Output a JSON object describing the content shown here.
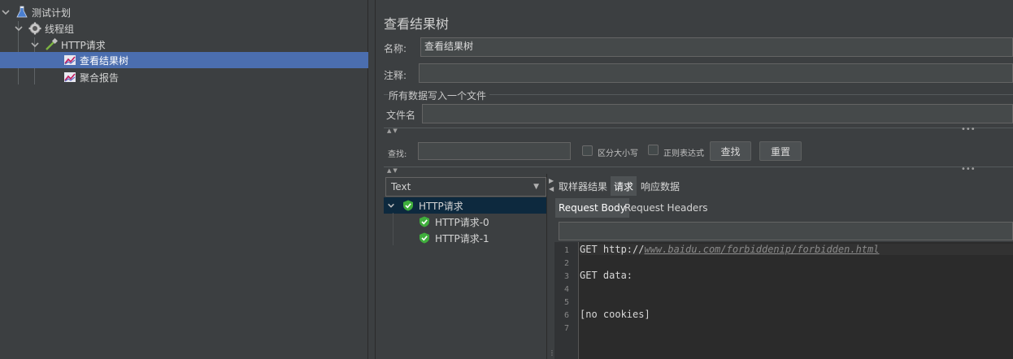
{
  "tree": {
    "items": [
      {
        "label": "测试计划"
      },
      {
        "label": "线程组"
      },
      {
        "label": "HTTP请求"
      },
      {
        "label": "查看结果树"
      },
      {
        "label": "聚合报告"
      }
    ]
  },
  "panel": {
    "title": "查看结果树",
    "name_label": "名称:",
    "name_value": "查看结果树",
    "comment_label": "注释:",
    "comment_value": "",
    "file_group_label": "所有数据写入一个文件",
    "filename_label": "文件名",
    "filename_value": ""
  },
  "search": {
    "label": "查找:",
    "value": "",
    "case_label": "区分大小写",
    "regex_label": "正则表达式",
    "find_button": "查找",
    "reset_button": "重置"
  },
  "renderer": {
    "selected": "Text",
    "dropdown_glyph": "▼"
  },
  "results": [
    {
      "label": "HTTP请求"
    },
    {
      "label": "HTTP请求-0"
    },
    {
      "label": "HTTP请求-1"
    }
  ],
  "tabs": {
    "main": [
      "取样器结果",
      "请求",
      "响应数据"
    ],
    "sub": [
      "Request Body",
      "Request Headers"
    ]
  },
  "code": {
    "line_numbers": [
      "1",
      "2",
      "3",
      "4",
      "5",
      "6",
      "7"
    ],
    "line1_prefix": "GET http://",
    "line1_link": "www.baidu.com/forbiddenip/forbidden.html",
    "line3": "GET data:",
    "line6": "[no cookies]"
  },
  "colors": {
    "selection": "#4b6eaf",
    "success_icon": "#3fae3c"
  }
}
